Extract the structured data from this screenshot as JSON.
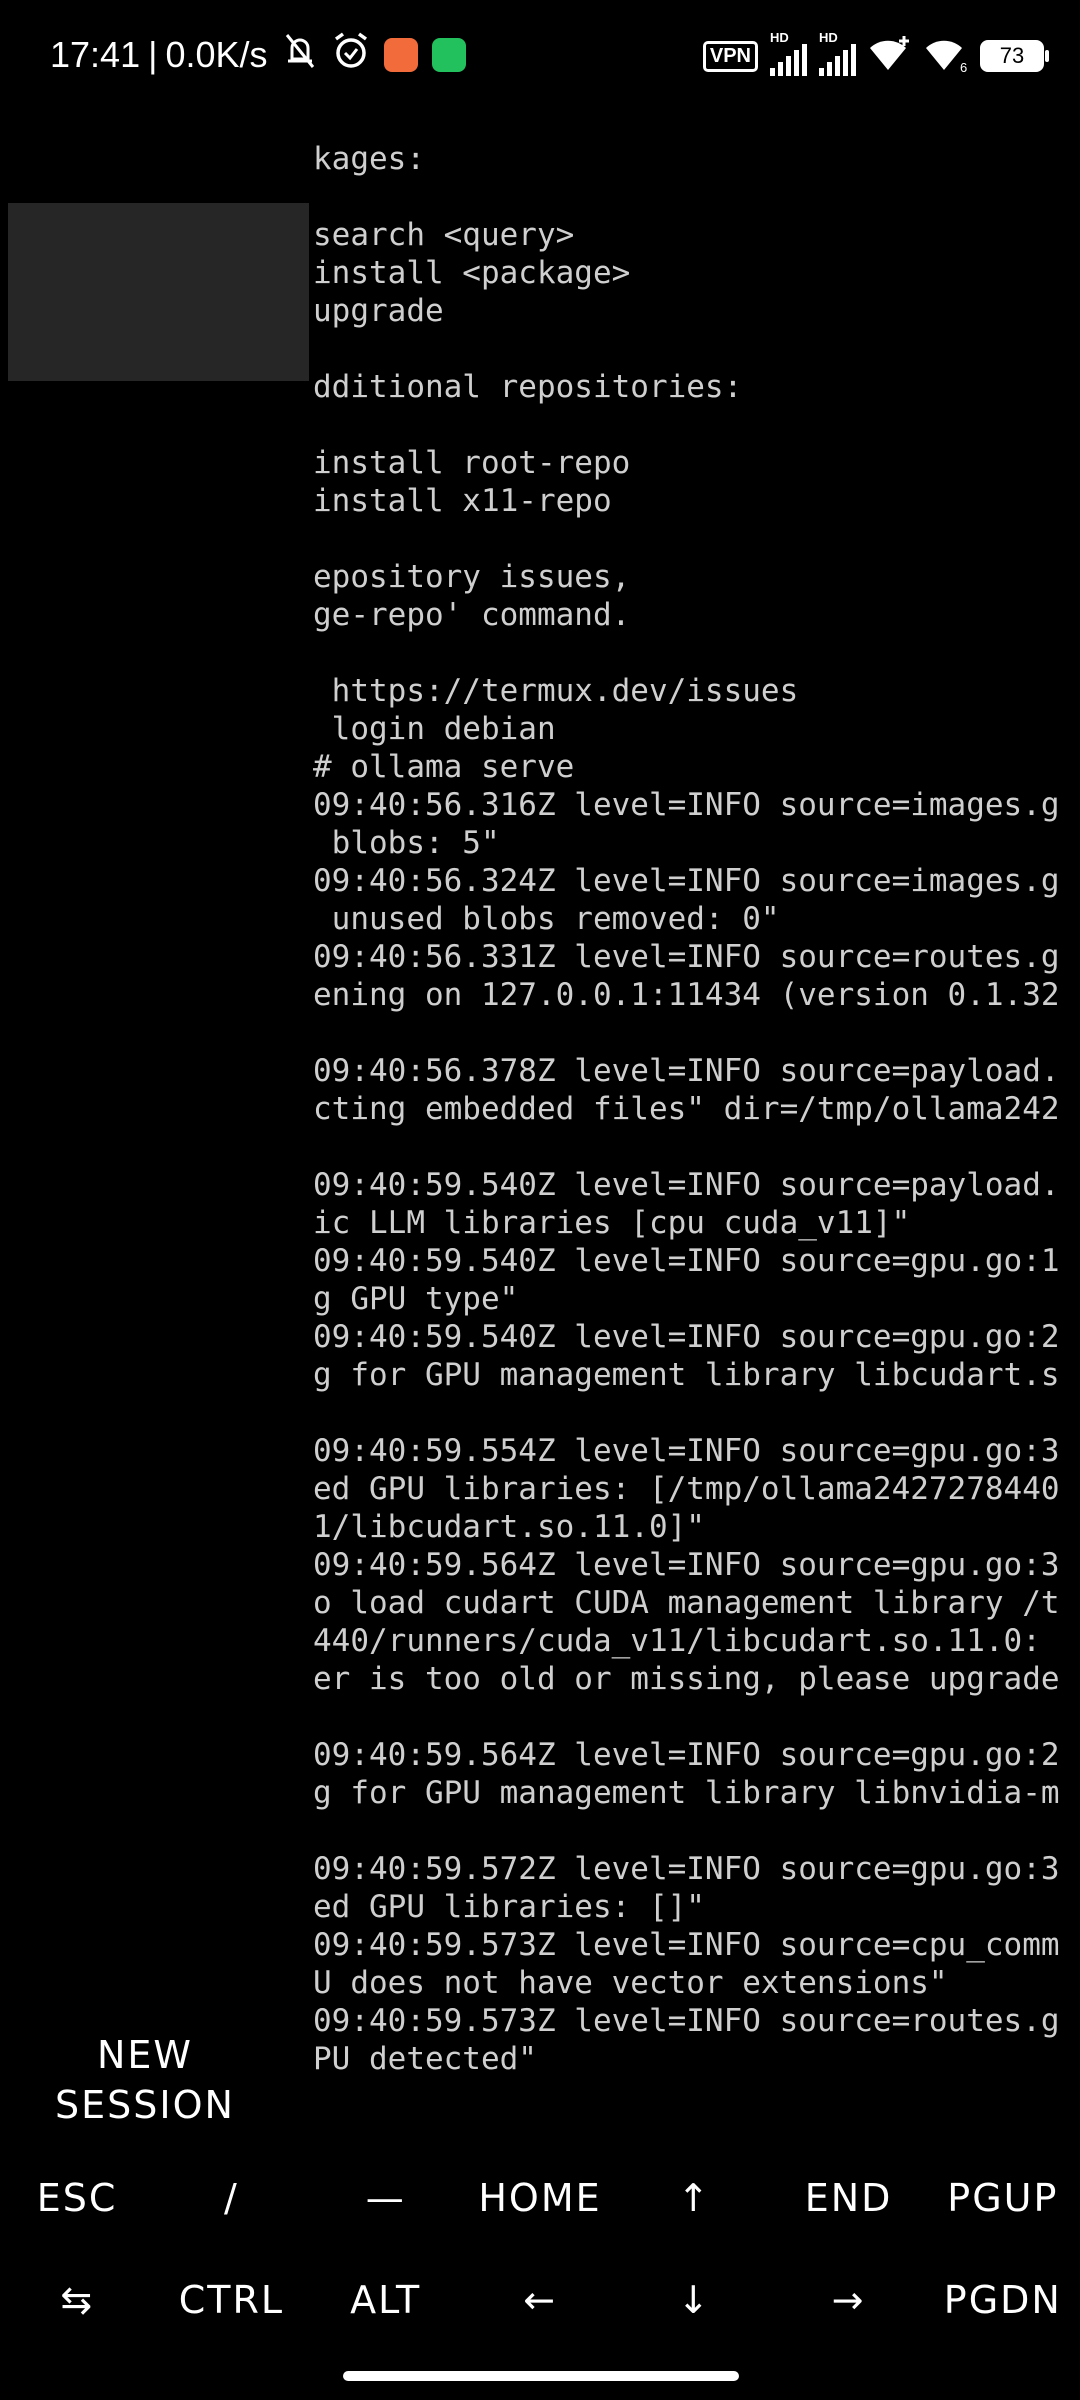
{
  "status_bar": {
    "time": "17:41",
    "separator": "|",
    "net_speed": "0.0K/s",
    "left_icons": [
      "bell-muted-icon",
      "alarm-icon",
      "mi-store-app-icon",
      "wechat-app-icon"
    ],
    "vpn_label": "VPN",
    "signal_labels": [
      "HD",
      "HD"
    ],
    "battery": "73",
    "colors": {
      "mi_store": "#f26b3a",
      "wechat": "#22c15e"
    }
  },
  "terminal": {
    "lines": [
      "kages:",
      "",
      "search <query>",
      "install <package>",
      "upgrade",
      "",
      "dditional repositories:",
      "",
      "install root-repo",
      "install x11-repo",
      "",
      "epository issues,",
      "ge-repo' command.",
      "",
      " https://termux.dev/issues",
      " login debian",
      "# ollama serve",
      "09:40:56.316Z level=INFO source=images.g",
      " blobs: 5\"",
      "09:40:56.324Z level=INFO source=images.g",
      " unused blobs removed: 0\"",
      "09:40:56.331Z level=INFO source=routes.g",
      "ening on 127.0.0.1:11434 (version 0.1.32",
      "",
      "09:40:56.378Z level=INFO source=payload.",
      "cting embedded files\" dir=/tmp/ollama242",
      "",
      "09:40:59.540Z level=INFO source=payload.",
      "ic LLM libraries [cpu cuda_v11]\"",
      "09:40:59.540Z level=INFO source=gpu.go:1",
      "g GPU type\"",
      "09:40:59.540Z level=INFO source=gpu.go:2",
      "g for GPU management library libcudart.s",
      "",
      "09:40:59.554Z level=INFO source=gpu.go:3",
      "ed GPU libraries: [/tmp/ollama2427278440",
      "1/libcudart.so.11.0]\"",
      "09:40:59.564Z level=INFO source=gpu.go:3",
      "o load cudart CUDA management library /t",
      "440/runners/cuda_v11/libcudart.so.11.0:",
      "er is too old or missing, please upgrade",
      "",
      "09:40:59.564Z level=INFO source=gpu.go:2",
      "g for GPU management library libnvidia-m",
      "",
      "09:40:59.572Z level=INFO source=gpu.go:3",
      "ed GPU libraries: []\"",
      "09:40:59.573Z level=INFO source=cpu_comm",
      "U does not have vector extensions\"",
      "09:40:59.573Z level=INFO source=routes.g",
      "PU detected\""
    ]
  },
  "drawer": {
    "new_session_line1": "NEW",
    "new_session_line2": "SESSION"
  },
  "extra_keys": {
    "row1": [
      "ESC",
      "/",
      "—",
      "HOME",
      "↑",
      "END",
      "PGUP"
    ],
    "row2": [
      "⇆",
      "CTRL",
      "ALT",
      "←",
      "↓",
      "→",
      "PGDN"
    ]
  }
}
